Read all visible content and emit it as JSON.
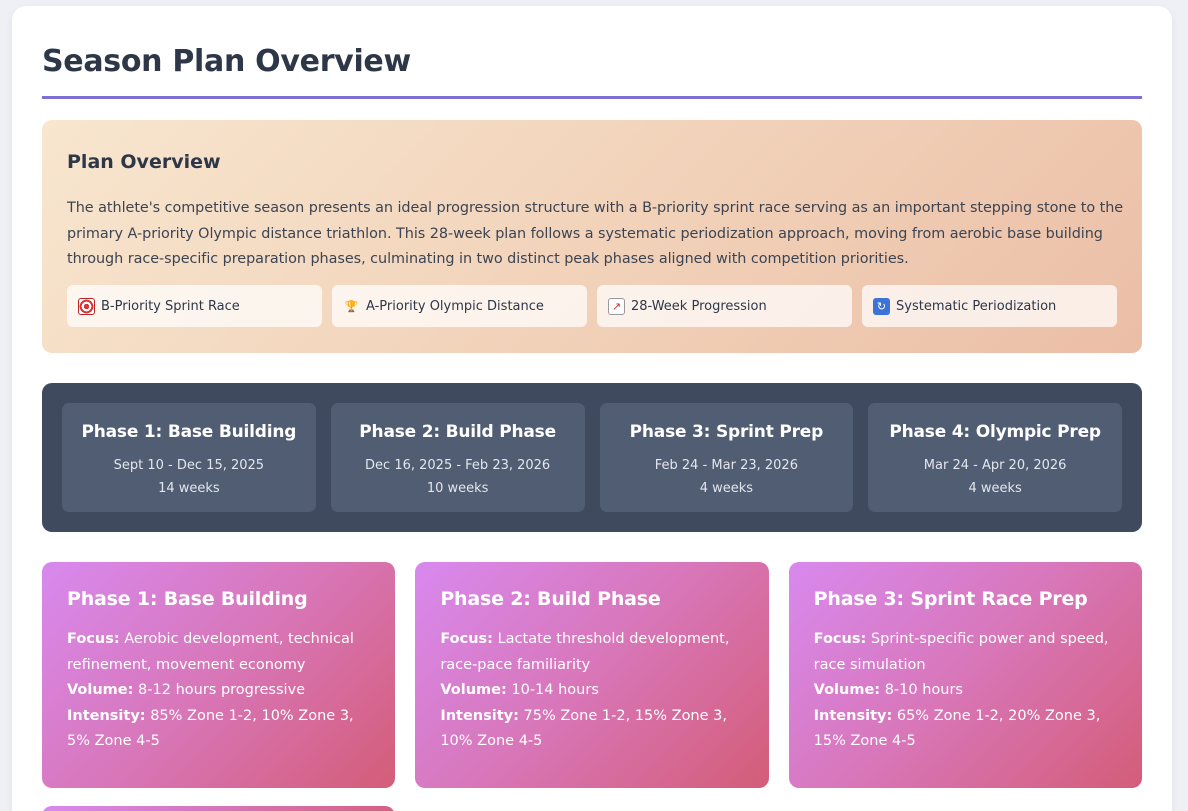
{
  "page": {
    "title": "Season Plan Overview"
  },
  "overview": {
    "heading": "Plan Overview",
    "body": "The athlete's competitive season presents an ideal progression structure with a B-priority sprint race serving as an important stepping stone to the primary A-priority Olympic distance triathlon. This 28-week plan follows a systematic periodization approach, moving from aerobic base building through race-specific preparation phases, culminating in two distinct peak phases aligned with competition priorities.",
    "tags": [
      {
        "icon": "target-icon",
        "label": "B-Priority Sprint Race"
      },
      {
        "icon": "trophy-icon",
        "label": "A-Priority Olympic Distance"
      },
      {
        "icon": "chart-increasing-icon",
        "label": "28-Week Progression"
      },
      {
        "icon": "cycle-arrows-icon",
        "label": "Systematic Periodization"
      }
    ]
  },
  "timeline": [
    {
      "name": "Phase 1: Base Building",
      "dates": "Sept 10 - Dec 15, 2025",
      "weeks": "14 weeks"
    },
    {
      "name": "Phase 2: Build Phase",
      "dates": "Dec 16, 2025 - Feb 23, 2026",
      "weeks": "10 weeks"
    },
    {
      "name": "Phase 3: Sprint Prep",
      "dates": "Feb 24 - Mar 23, 2026",
      "weeks": "4 weeks"
    },
    {
      "name": "Phase 4: Olympic Prep",
      "dates": "Mar 24 - Apr 20, 2026",
      "weeks": "4 weeks"
    }
  ],
  "labels": {
    "focus": "Focus:",
    "volume": "Volume:",
    "intensity": "Intensity:"
  },
  "phases": [
    {
      "title": "Phase 1: Base Building",
      "focus": "Aerobic development, technical refinement, movement economy",
      "volume": "8-12 hours progressive",
      "intensity": "85% Zone 1-2, 10% Zone 3, 5% Zone 4-5"
    },
    {
      "title": "Phase 2: Build Phase",
      "focus": "Lactate threshold development, race-pace familiarity",
      "volume": "10-14 hours",
      "intensity": "75% Zone 1-2, 15% Zone 3, 10% Zone 4-5"
    },
    {
      "title": "Phase 3: Sprint Race Prep",
      "focus": "Sprint-specific power and speed, race simulation",
      "volume": "8-10 hours",
      "intensity": "65% Zone 1-2, 20% Zone 3, 15% Zone 4-5"
    }
  ],
  "colors": {
    "accent_rule": "#7c6fd6",
    "timeline_bg": "#3f4a5f",
    "timeline_card": "#515d73",
    "phase_gradient_start": "#d889ef",
    "phase_gradient_end": "#d45d78"
  }
}
